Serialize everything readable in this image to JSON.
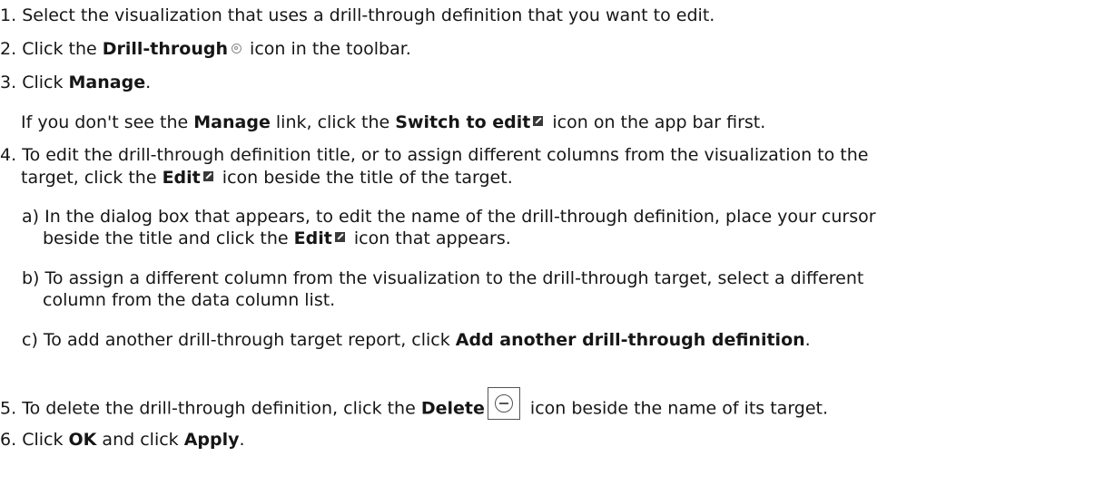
{
  "steps": {
    "s1": {
      "num": "1.",
      "text": "Select the visualization that uses a drill-through definition that you want to edit."
    },
    "s2": {
      "num": "2.",
      "pre": "Click the ",
      "bold": "Drill-through",
      "post": " icon in the toolbar."
    },
    "s3": {
      "num": "3.",
      "pre": "Click ",
      "bold": "Manage",
      "post": "."
    },
    "s3_note": {
      "pre": "If you don't see the ",
      "bold1": "Manage",
      "mid": " link, click the ",
      "bold2": "Switch to edit",
      "post": " icon on the app bar first."
    },
    "s4": {
      "num": "4.",
      "line1": "To edit the drill-through definition title, or to assign different columns from the visualization to the",
      "line2_pre": "target, click the ",
      "line2_bold": "Edit",
      "line2_post": " icon beside the title of the target.",
      "a": {
        "label": "a)",
        "line1": "In the dialog box that appears, to edit the name of the drill-through definition, place your cursor",
        "line2_pre": "beside the title and click the ",
        "line2_bold": "Edit",
        "line2_post": " icon that appears."
      },
      "b": {
        "label": "b)",
        "line1": "To assign a different column from the visualization to the drill-through target, select a different",
        "line2": "column from the data column list."
      },
      "c": {
        "label": "c)",
        "pre": "To add another drill-through target report, click ",
        "bold": "Add another drill-through definition",
        "post": "."
      }
    },
    "s5": {
      "num": "5.",
      "pre": "To delete the drill-through definition, click the ",
      "bold": "Delete",
      "post": " icon beside the name of its target."
    },
    "s6": {
      "num": "6.",
      "pre": "Click ",
      "bold1": "OK",
      "mid": " and click ",
      "bold2": "Apply",
      "post": "."
    }
  }
}
